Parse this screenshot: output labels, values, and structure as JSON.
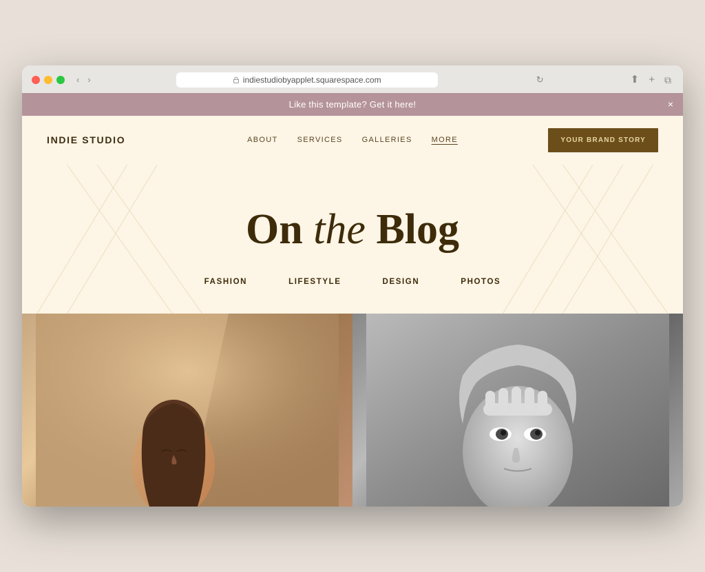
{
  "browser": {
    "address": "indiestudiobyapplet.squarespace.com",
    "reload_title": "Reload page"
  },
  "announcement": {
    "text": "Like this template? Get it here!",
    "close_label": "×"
  },
  "header": {
    "logo": "INDIE STUDIO",
    "nav": [
      {
        "label": "ABOUT",
        "active": false
      },
      {
        "label": "SERVICES",
        "active": false
      },
      {
        "label": "GALLERIES",
        "active": false
      },
      {
        "label": "MORE",
        "active": true
      }
    ],
    "cta_label": "YOUR BRAND STORY"
  },
  "hero": {
    "title_part1": "On ",
    "title_italic": "the",
    "title_part2": " Blog"
  },
  "categories": [
    {
      "label": "FASHION"
    },
    {
      "label": "LIFESTYLE"
    },
    {
      "label": "DESIGN"
    },
    {
      "label": "PHOTOS"
    }
  ],
  "blog_posts": [
    {
      "id": 1,
      "type": "warm",
      "alt": "Person with warm tones"
    },
    {
      "id": 2,
      "type": "bw",
      "alt": "Person covering face in black and white"
    }
  ]
}
